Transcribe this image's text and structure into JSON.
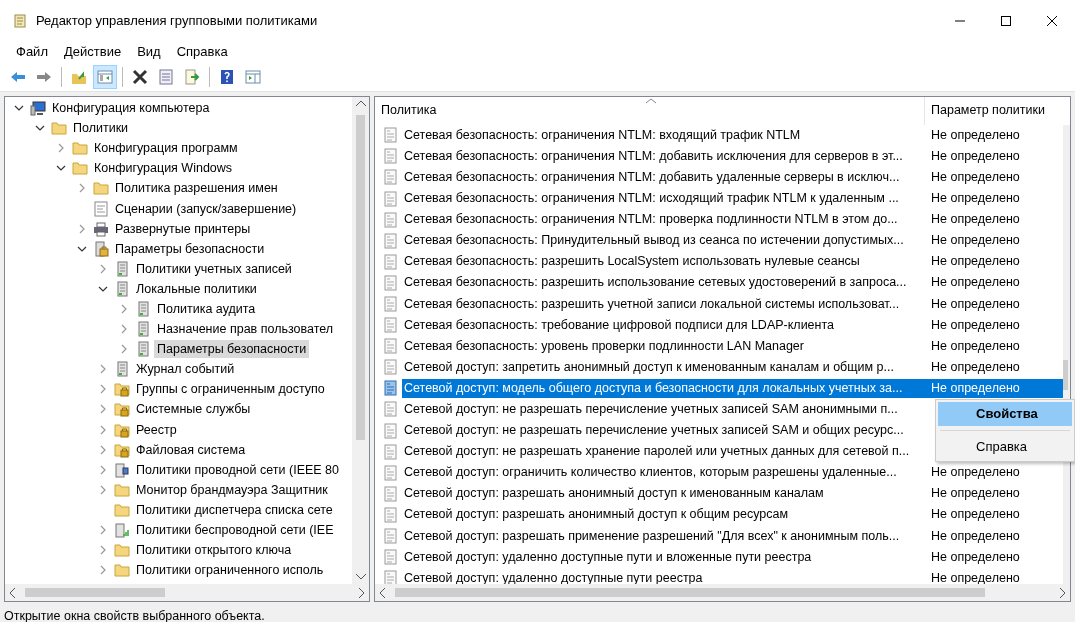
{
  "window": {
    "title": "Редактор управления групповыми политиками"
  },
  "menu": [
    "Файл",
    "Действие",
    "Вид",
    "Справка"
  ],
  "toolbar": [
    {
      "kind": "back",
      "selected": false
    },
    {
      "kind": "forward",
      "selected": false
    },
    {
      "kind": "sep"
    },
    {
      "kind": "up",
      "selected": false
    },
    {
      "kind": "tree",
      "selected": true
    },
    {
      "kind": "sep"
    },
    {
      "kind": "delete",
      "selected": false
    },
    {
      "kind": "properties",
      "selected": false
    },
    {
      "kind": "export",
      "selected": false
    },
    {
      "kind": "sep"
    },
    {
      "kind": "help",
      "selected": false
    },
    {
      "kind": "panel",
      "selected": false
    }
  ],
  "tree": [
    {
      "label": "Конфигурация компьютера",
      "kind": "computer",
      "expandable": true,
      "expanded": true,
      "selected": false,
      "children": [
        {
          "label": "Политики",
          "kind": "folder",
          "expandable": true,
          "expanded": true,
          "selected": false,
          "children": [
            {
              "label": "Конфигурация программ",
              "kind": "folder",
              "expandable": true,
              "expanded": false,
              "selected": false
            },
            {
              "label": "Конфигурация Windows",
              "kind": "folder",
              "expandable": true,
              "expanded": true,
              "selected": false,
              "children": [
                {
                  "label": "Политика разрешения имен",
                  "kind": "folder",
                  "expandable": true,
                  "expanded": false,
                  "selected": false
                },
                {
                  "label": "Сценарии (запуск/завершение)",
                  "kind": "script",
                  "expandable": false,
                  "selected": false
                },
                {
                  "label": "Развернутые принтеры",
                  "kind": "printer",
                  "expandable": true,
                  "expanded": false,
                  "selected": false
                },
                {
                  "label": "Параметры безопасности",
                  "kind": "security",
                  "expandable": true,
                  "expanded": true,
                  "selected": false,
                  "children": [
                    {
                      "label": "Политики учетных записей",
                      "kind": "server",
                      "expandable": true,
                      "expanded": false,
                      "selected": false
                    },
                    {
                      "label": "Локальные политики",
                      "kind": "server",
                      "expandable": true,
                      "expanded": true,
                      "selected": false,
                      "children": [
                        {
                          "label": "Политика аудита",
                          "kind": "server",
                          "expandable": true,
                          "expanded": false,
                          "selected": false
                        },
                        {
                          "label": "Назначение прав пользовател",
                          "kind": "server",
                          "expandable": true,
                          "expanded": false,
                          "selected": false
                        },
                        {
                          "label": "Параметры безопасности",
                          "kind": "server",
                          "expandable": true,
                          "expanded": false,
                          "selected": true
                        }
                      ]
                    },
                    {
                      "label": "Журнал событий",
                      "kind": "server",
                      "expandable": true,
                      "expanded": false,
                      "selected": false
                    },
                    {
                      "label": "Группы с ограниченным доступо",
                      "kind": "lockfolder",
                      "expandable": true,
                      "expanded": false,
                      "selected": false
                    },
                    {
                      "label": "Системные службы",
                      "kind": "lockfolder",
                      "expandable": true,
                      "expanded": false,
                      "selected": false
                    },
                    {
                      "label": "Реестр",
                      "kind": "lockfolder",
                      "expandable": true,
                      "expanded": false,
                      "selected": false
                    },
                    {
                      "label": "Файловая система",
                      "kind": "lockfolder",
                      "expandable": true,
                      "expanded": false,
                      "selected": false
                    },
                    {
                      "label": "Политики проводной сети (IEEE 80",
                      "kind": "wired",
                      "expandable": true,
                      "expanded": false,
                      "selected": false
                    },
                    {
                      "label": "Монитор брандмауэра Защитник",
                      "kind": "folder",
                      "expandable": true,
                      "expanded": false,
                      "selected": false
                    },
                    {
                      "label": "Политики диспетчера списка сете",
                      "kind": "folder",
                      "expandable": false,
                      "selected": false
                    },
                    {
                      "label": "Политики беспроводной сети (IEE",
                      "kind": "wireless",
                      "expandable": true,
                      "expanded": false,
                      "selected": false
                    },
                    {
                      "label": "Политики открытого ключа",
                      "kind": "folder",
                      "expandable": true,
                      "expanded": false,
                      "selected": false
                    },
                    {
                      "label": "Политики ограниченного исполь",
                      "kind": "folder",
                      "expandable": true,
                      "expanded": false,
                      "selected": false
                    }
                  ]
                }
              ]
            }
          ]
        }
      ]
    }
  ],
  "list": {
    "columns": [
      "Политика",
      "Параметр политики"
    ],
    "rows": [
      {
        "policy": "Сетевая безопасность: ограничения NTLM: входящий трафик NTLM",
        "setting": "Не определено",
        "selected": false
      },
      {
        "policy": "Сетевая безопасность: ограничения NTLM: добавить исключения для серверов в эт...",
        "setting": "Не определено",
        "selected": false
      },
      {
        "policy": "Сетевая безопасность: ограничения NTLM: добавить удаленные серверы в исключ...",
        "setting": "Не определено",
        "selected": false
      },
      {
        "policy": "Сетевая безопасность: ограничения NTLM: исходящий трафик NTLM к удаленным ...",
        "setting": "Не определено",
        "selected": false
      },
      {
        "policy": "Сетевая безопасность: ограничения NTLM: проверка подлинности NTLM в этом до...",
        "setting": "Не определено",
        "selected": false
      },
      {
        "policy": "Сетевая безопасность: Принудительный вывод из сеанса по истечении допустимых...",
        "setting": "Не определено",
        "selected": false
      },
      {
        "policy": "Сетевая безопасность: разрешить LocalSystem использовать нулевые сеансы",
        "setting": "Не определено",
        "selected": false
      },
      {
        "policy": "Сетевая безопасность: разрешить использование сетевых удостоверений в запроса...",
        "setting": "Не определено",
        "selected": false
      },
      {
        "policy": "Сетевая безопасность: разрешить учетной записи локальной системы использоват...",
        "setting": "Не определено",
        "selected": false
      },
      {
        "policy": "Сетевая безопасность: требование цифровой подписи для LDAP-клиента",
        "setting": "Не определено",
        "selected": false
      },
      {
        "policy": "Сетевая безопасность: уровень проверки подлинности LAN Manager",
        "setting": "Не определено",
        "selected": false
      },
      {
        "policy": "Сетевой доступ: запретить анонимный доступ к именованным каналам и общим р...",
        "setting": "Не определено",
        "selected": false
      },
      {
        "policy": "Сетевой доступ: модель общего доступа и безопасности для локальных учетных за...",
        "setting": "Не определено",
        "selected": true
      },
      {
        "policy": "Сетевой доступ: не разрешать перечисление учетных записей SAM анонимными п...",
        "selected": false
      },
      {
        "policy": "Сетевой доступ: не разрешать перечисление учетных записей SAM и общих ресурс...",
        "selected": false
      },
      {
        "policy": "Сетевой доступ: не разрешать хранение паролей или учетных данных для сетевой п...",
        "selected": false
      },
      {
        "policy": "Сетевой доступ: ограничить количество клиентов, которым разрешены удаленные...",
        "setting": "Не определено",
        "selected": false
      },
      {
        "policy": "Сетевой доступ: разрешать анонимный доступ к именованным каналам",
        "setting": "Не определено",
        "selected": false
      },
      {
        "policy": "Сетевой доступ: разрешать анонимный доступ к общим ресурсам",
        "setting": "Не определено",
        "selected": false
      },
      {
        "policy": "Сетевой доступ: разрешать применение разрешений \"Для всех\" к анонимным поль...",
        "setting": "Не определено",
        "selected": false
      },
      {
        "policy": "Сетевой доступ: удаленно доступные пути и вложенные пути реестра",
        "setting": "Не определено",
        "selected": false
      },
      {
        "policy": "Сетевой доступ: удаленно доступные пути реестра",
        "setting": "Не определено",
        "selected": false
      }
    ]
  },
  "context_menu": [
    {
      "label": "Свойства",
      "highlighted": true
    },
    {
      "label": "Справка",
      "highlighted": false
    }
  ],
  "status_bar": "Открытие окна свойств выбранного объекта."
}
